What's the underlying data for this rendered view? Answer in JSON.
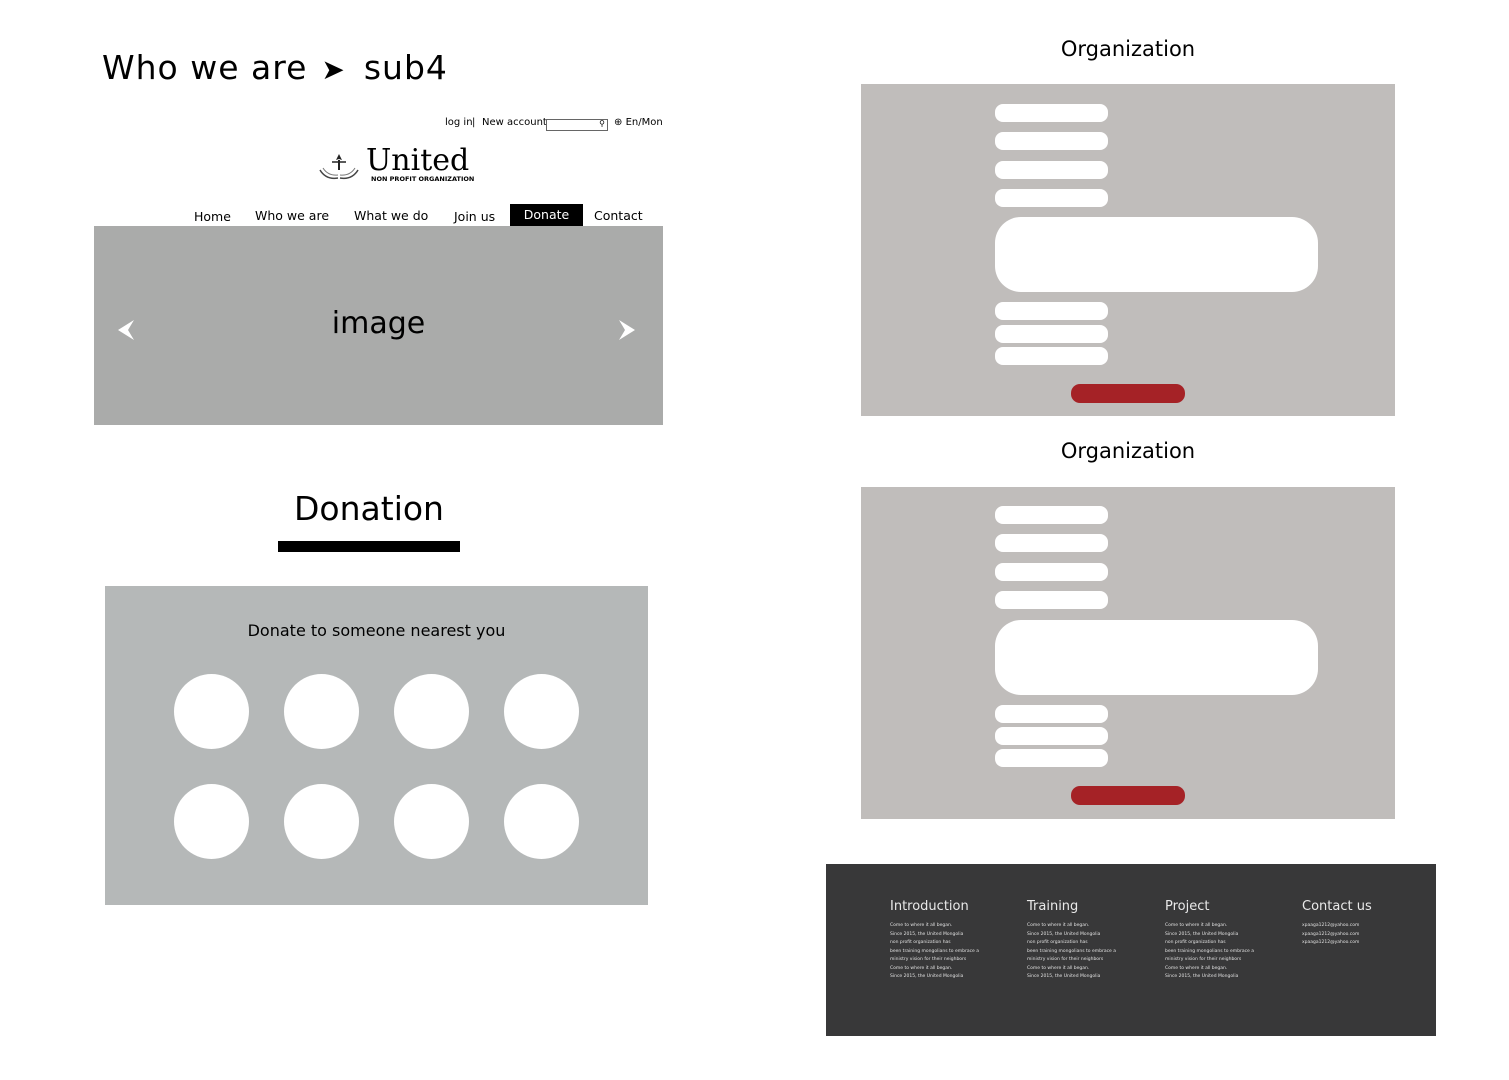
{
  "page": {
    "title": "Who we are",
    "subtitle": "sub4"
  },
  "topbar": {
    "login": "log in",
    "separator": "|",
    "new_account": "New account",
    "language": "En/Mon"
  },
  "logo": {
    "name": "United",
    "tagline": "NON PROFIT ORGANIZATION"
  },
  "nav": [
    {
      "label": "Home"
    },
    {
      "label": "Who we are"
    },
    {
      "label": "What we do"
    },
    {
      "label": "Join us"
    },
    {
      "label": "Donate",
      "active": true
    },
    {
      "label": "Contact"
    }
  ],
  "hero": {
    "label": "image"
  },
  "donation": {
    "title": "Donation",
    "panel_heading": "Donate to someone nearest you",
    "circle_count": 8
  },
  "organization": [
    {
      "heading": "Organization"
    },
    {
      "heading": "Organization"
    }
  ],
  "footer": {
    "columns": [
      {
        "heading": "Introduction",
        "lines": [
          "Come to where it all began.",
          "Since 2015, the United Mongolia",
          "non profit organization has",
          "been training mongolians to embrace a",
          "ministry vision for their neighbors",
          "Come to where it all began.",
          "Since 2015, the United Mongolia"
        ]
      },
      {
        "heading": "Training",
        "lines": [
          "Come to where it all began.",
          "Since 2015, the United Mongolia",
          "non profit organization has",
          "been training mongolians to embrace a",
          "ministry vision for their neighbors",
          "Come to where it all began.",
          "Since 2015, the United Mongolia"
        ]
      },
      {
        "heading": "Project",
        "lines": [
          "Come to where it all began.",
          "Since 2015, the United Mongolia",
          "non profit organization has",
          "been training mongolians to embrace a",
          "ministry vision for their neighbors",
          "Come to where it all began.",
          "Since 2015, the United Mongolia"
        ]
      },
      {
        "heading": "Contact us",
        "lines": [
          "xpaaga1212@yahoo.com",
          "xpaaga1212@yahoo.com",
          "xpaaga1212@yahoo.com"
        ]
      }
    ]
  },
  "colors": {
    "hero_bg": "#aaabaa",
    "donate_panel_bg": "#b5b8b8",
    "org_panel_bg": "#c0bdbb",
    "submit_button": "#a52226",
    "footer_bg": "#383839",
    "nav_active_bg": "#000000"
  },
  "icons": [
    "arrow-right-icon",
    "search-icon",
    "globe-icon",
    "logo-hands-icon",
    "chevron-left-icon",
    "chevron-right-icon"
  ]
}
